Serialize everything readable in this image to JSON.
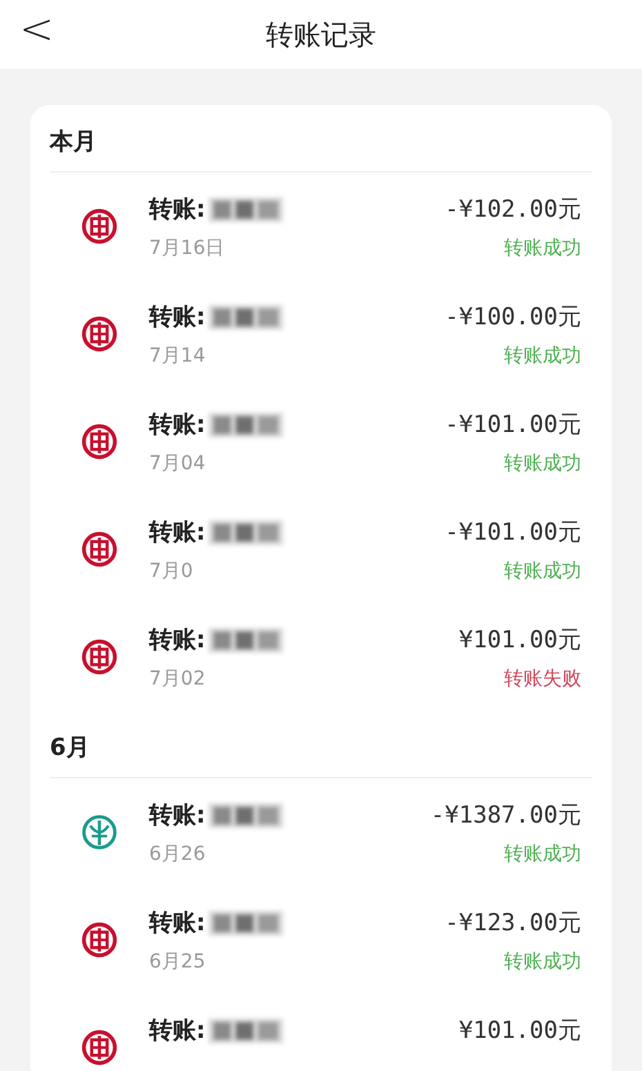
{
  "header": {
    "back": "<",
    "title": "转账记录"
  },
  "sections": [
    {
      "heading": "本月",
      "rows": [
        {
          "kind": "seal",
          "title": "转账:",
          "date": "7月16日",
          "amount": "-¥102.00元",
          "status": "转账成功",
          "success": true
        },
        {
          "kind": "seal",
          "title": "转账:",
          "date": "7月14",
          "amount": "-¥100.00元",
          "status": "转账成功",
          "success": true
        },
        {
          "kind": "seal",
          "title": "转账:",
          "date": "7月04",
          "amount": "-¥101.00元",
          "status": "转账成功",
          "success": true
        },
        {
          "kind": "seal",
          "title": "转账:",
          "date": "7月0",
          "amount": "-¥101.00元",
          "status": "转账成功",
          "success": true
        },
        {
          "kind": "seal",
          "title": "转账:",
          "date": "7月02",
          "amount": "¥101.00元",
          "status": "转账失败",
          "success": false
        }
      ]
    },
    {
      "heading": "6月",
      "rows": [
        {
          "kind": "wheat",
          "title": "转账:",
          "date": "6月26",
          "amount": "-¥1387.00元",
          "status": "转账成功",
          "success": true
        },
        {
          "kind": "seal",
          "title": "转账:",
          "date": "6月25",
          "amount": "-¥123.00元",
          "status": "转账成功",
          "success": true
        },
        {
          "kind": "seal",
          "title": "转账:",
          "amount": "¥101.00元"
        }
      ]
    }
  ]
}
